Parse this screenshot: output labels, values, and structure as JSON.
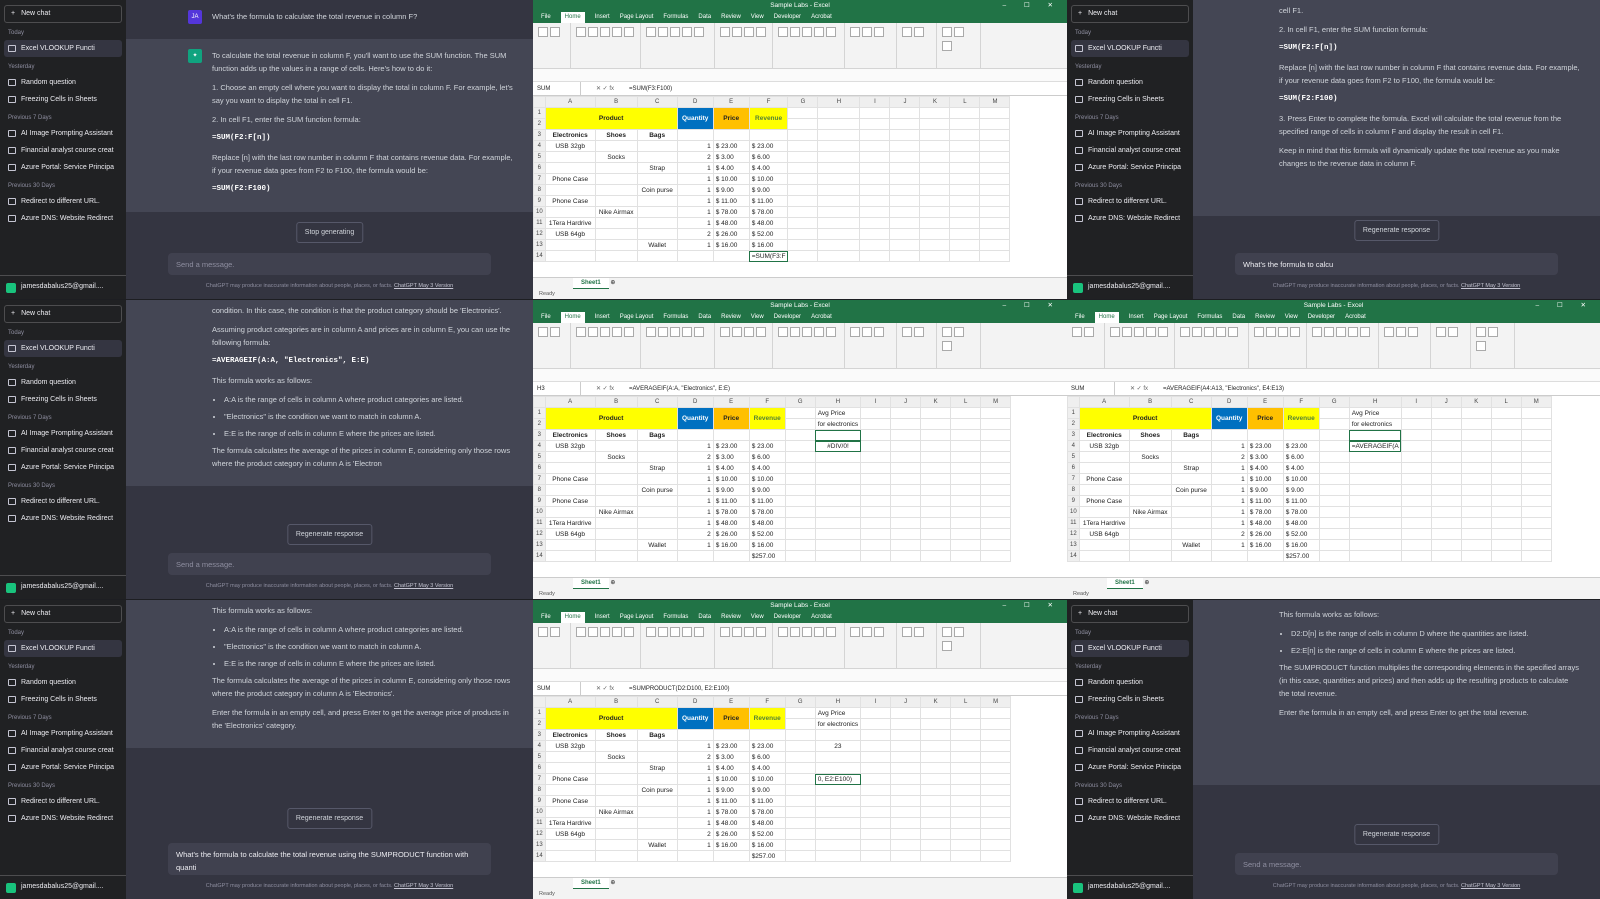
{
  "chatgpt": {
    "new_chat": "New chat",
    "groups": {
      "today": "Today",
      "yesterday": "Yesterday",
      "prev7": "Previous 7 Days",
      "prev30": "Previous 30 Days"
    },
    "today_items": [
      "Excel VLOOKUP Functi"
    ],
    "yesterday_items": [
      "Random question",
      "Freezing Cells in Sheets"
    ],
    "prev7_items": [
      "AI Image Prompting Assistant",
      "Financial analyst course creat",
      "Azure Portal: Service Principa"
    ],
    "prev30_items": [
      "Redirect to different URL.",
      "Azure DNS: Website Redirect"
    ],
    "user_email": "jamesdabalus25@gmail....",
    "placeholder": "Send a message.",
    "regenerate": "Regenerate response",
    "stop": "Stop generating",
    "footer": "ChatGPT may produce inaccurate information about people, places, or facts.",
    "footer_link": "ChatGPT May 3 Version",
    "user_initials": "JA",
    "panel1": {
      "question": "What's the formula to calculate the total revenue in column F?",
      "p1": "To calculate the total revenue in column F, you'll want to use the SUM function. The SUM function adds up the values in a range of cells. Here's how to do it:",
      "s1": "1. Choose an empty cell where you want to display the total in column F. For example, let's say you want to display the total in cell F1.",
      "s2": "2. In cell F1, enter the SUM function formula:",
      "code1": "=SUM(F2:F[n])",
      "s3": "Replace [n] with the last row number in column F that contains revenue data. For example, if your revenue data goes from F2 to F100, the formula would be:",
      "code2": "=SUM(F2:F100)"
    },
    "panel2": {
      "p0": "condition. In this case, the condition is that the product category should be 'Electronics'.",
      "p1": "Assuming product categories are in column A and prices are in column E, you can use the following formula:",
      "code": "=AVERAGEIF(A:A, \"Electronics\", E:E)",
      "p2": "This formula works as follows:",
      "b1": "A:A is the range of cells in column A where product categories are listed.",
      "b2": "\"Electronics\" is the condition we want to match in column A.",
      "b3": "E:E is the range of cells in column E where the prices are listed.",
      "p3": "The formula calculates the average of the prices in column E, considering only those rows where the product category in column A is 'Electron"
    },
    "panel3": {
      "p0": "This formula works as follows:",
      "b1": "A:A is the range of cells in column A where product categories are listed.",
      "b2": "\"Electronics\" is the condition we want to match in column A.",
      "b3": "E:E is the range of cells in column E where the prices are listed.",
      "p1": "The formula calculates the average of the prices in column E, considering only those rows where the product category in column A is 'Electronics'.",
      "p2": "Enter the formula in an empty cell, and press Enter to get the average price of products in the 'Electronics' category.",
      "input": "What's the formula to calculate the total revenue using the SUMPRODUCT function with quanti"
    },
    "panel4": {
      "s1": "cell F1.",
      "s2": "2. In cell F1, enter the SUM function formula:",
      "code1": "=SUM(F2:F[n])",
      "s3": "Replace [n] with the last row number in column F that contains revenue data. For example, if your revenue data goes from F2 to F100, the formula would be:",
      "code2": "=SUM(F2:F100)",
      "s4": "3. Press Enter to complete the formula. Excel will calculate the total revenue from the specified range of cells in column F and display the result in cell F1.",
      "p1": "Keep in mind that this formula will dynamically update the total revenue as you make changes to the revenue data in column F.",
      "input": "What's the formula to calcu"
    },
    "panel6": {
      "p0": "This formula works as follows:",
      "b1": "D2:D[n] is the range of cells in column D where the quantities are listed.",
      "b2": "E2:E[n] is the range of cells in column E where the prices are listed.",
      "p1": "The SUMPRODUCT function multiplies the corresponding elements in the specified arrays (in this case, quantities and prices) and then adds up the resulting products to calculate the total revenue.",
      "p2": "Enter the formula in an empty cell, and press Enter to get the total revenue."
    }
  },
  "excel": {
    "title": "Sample Labs - Excel",
    "menu": [
      "File",
      "Home",
      "Insert",
      "Page Layout",
      "Formulas",
      "Data",
      "Review",
      "View",
      "Developer",
      "Acrobat"
    ],
    "sheet_tab": "Sheet1",
    "status": "Ready",
    "col_headers": [
      "A",
      "B",
      "C",
      "D",
      "E",
      "F",
      "G",
      "H",
      "I",
      "J",
      "K",
      "L",
      "M"
    ],
    "headers": {
      "product": "Product",
      "quantity": "Quantity",
      "price": "Price",
      "revenue": "Revenue"
    },
    "subheaders": [
      "Electronics",
      "Shoes",
      "Bags"
    ],
    "rows": [
      {
        "a": "USB 32gb",
        "b": "",
        "c": "",
        "d": "1",
        "e": "$ 23.00",
        "f": "$ 23.00"
      },
      {
        "a": "",
        "b": "Socks",
        "c": "",
        "d": "2",
        "e": "$ 3.00",
        "f": "$ 6.00"
      },
      {
        "a": "",
        "b": "",
        "c": "Strap",
        "d": "1",
        "e": "$ 4.00",
        "f": "$ 4.00"
      },
      {
        "a": "Phone Case",
        "b": "",
        "c": "",
        "d": "1",
        "e": "$ 10.00",
        "f": "$ 10.00"
      },
      {
        "a": "",
        "b": "",
        "c": "Coin purse",
        "d": "1",
        "e": "$ 9.00",
        "f": "$ 9.00"
      },
      {
        "a": "Phone Case",
        "b": "",
        "c": "",
        "d": "1",
        "e": "$ 11.00",
        "f": "$ 11.00"
      },
      {
        "a": "",
        "b": "Nike Airmax",
        "c": "",
        "d": "1",
        "e": "$ 78.00",
        "f": "$ 78.00"
      },
      {
        "a": "1Tera Hardrive",
        "b": "",
        "c": "",
        "d": "1",
        "e": "$ 48.00",
        "f": "$ 48.00"
      },
      {
        "a": "USB 64gb",
        "b": "",
        "c": "",
        "d": "2",
        "e": "$ 26.00",
        "f": "$ 52.00"
      },
      {
        "a": "",
        "b": "",
        "c": "Wallet",
        "d": "1",
        "e": "$ 16.00",
        "f": "$ 16.00"
      }
    ],
    "total": "$257.00",
    "avg_label1": "Avg Price",
    "avg_label2": "for electronics",
    "panels": [
      {
        "namebox": "SUM",
        "formula": "=SUM(F3:F100)",
        "f14": "=SUM(F3:F",
        "h": "",
        "h2": ""
      },
      {
        "namebox": "H3",
        "formula": "=AVERAGEIF(A:A, \"Electronics\", E:E)",
        "f14": "$257.00",
        "h": "#DIV/0!",
        "h2": ""
      },
      {
        "namebox": "SUM",
        "formula": "=AVERAGEIF(A4:A13, \"Electronics\", E4:E13)",
        "f14": "$257.00",
        "h": "=AVERAGEIF(A",
        "h2": ""
      },
      {
        "namebox": "SUM",
        "formula": "=SUMPRODUCT(D2:D100, E2:E100)",
        "f14": "$257.00",
        "h": "23",
        "h2": "0, E2:E100)"
      }
    ]
  }
}
